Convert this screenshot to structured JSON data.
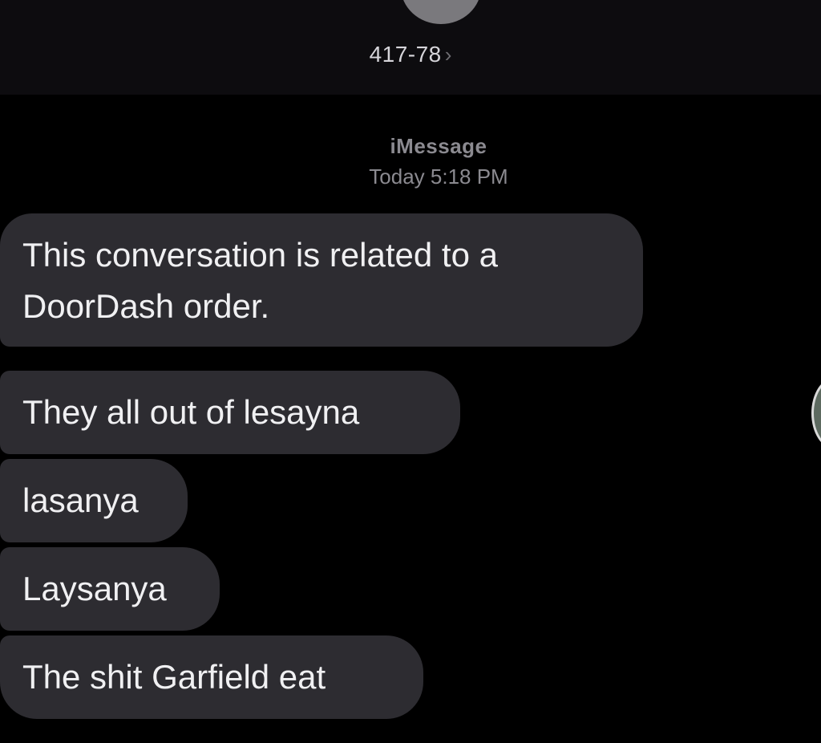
{
  "header": {
    "contact": "417-78",
    "chevron": "›"
  },
  "meta": {
    "service": "iMessage",
    "timestamp": "Today 5:18 PM"
  },
  "messages": [
    {
      "text": "This conversation is related to a DoorDash order."
    },
    {
      "text": "They all out of lesayna"
    },
    {
      "text": "lasanya"
    },
    {
      "text": "Laysanya"
    },
    {
      "text": "The shit Garfield eat"
    }
  ],
  "colors": {
    "background": "#000000",
    "header": "#0d0c0f",
    "incoming_bubble": "#2d2c31",
    "bubble_text": "#f0f0f2",
    "meta_text": "#8b8a90"
  }
}
